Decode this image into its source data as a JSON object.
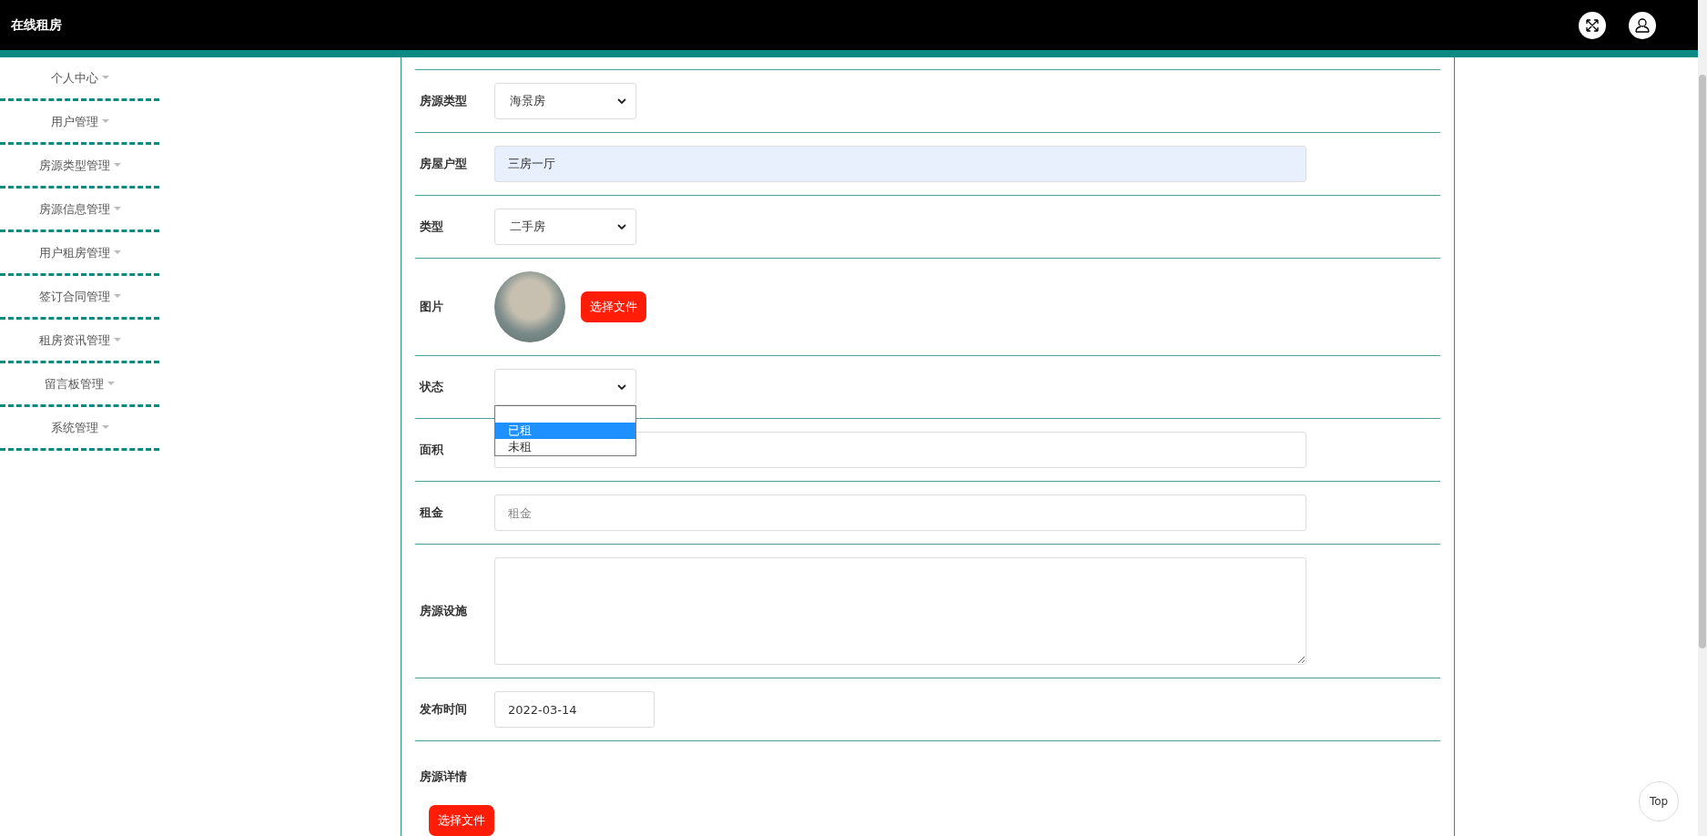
{
  "header": {
    "title": "在线租房"
  },
  "sidebar": {
    "items": [
      {
        "label": "个人中心"
      },
      {
        "label": "用户管理"
      },
      {
        "label": "房源类型管理"
      },
      {
        "label": "房源信息管理"
      },
      {
        "label": "用户租房管理"
      },
      {
        "label": "签订合同管理"
      },
      {
        "label": "租房资讯管理"
      },
      {
        "label": "留言板管理"
      },
      {
        "label": "系统管理"
      }
    ]
  },
  "form": {
    "rows": [
      {
        "kind": "select",
        "label": "房源类型",
        "value": "海景房",
        "open": false
      },
      {
        "kind": "input",
        "label": "房屋户型",
        "value": "三房一厅",
        "autofilled": true
      },
      {
        "kind": "select",
        "label": "类型",
        "value": "二手房",
        "open": false
      },
      {
        "kind": "image",
        "label": "图片",
        "button": "选择文件"
      },
      {
        "kind": "select",
        "label": "状态",
        "open": true,
        "options": [
          {
            "label": "已租",
            "selected": true
          },
          {
            "label": "未租",
            "selected": false
          }
        ]
      },
      {
        "kind": "input",
        "label": "面积",
        "autofilled": false
      },
      {
        "kind": "input",
        "label": "租金",
        "placeholder": "租金",
        "autofilled": false
      },
      {
        "kind": "textarea",
        "label": "房源设施"
      },
      {
        "kind": "date",
        "label": "发布时间",
        "value": "2022-03-14"
      },
      {
        "kind": "file",
        "label": "房源详情",
        "button": "选择文件"
      }
    ]
  },
  "top_button": "Top"
}
